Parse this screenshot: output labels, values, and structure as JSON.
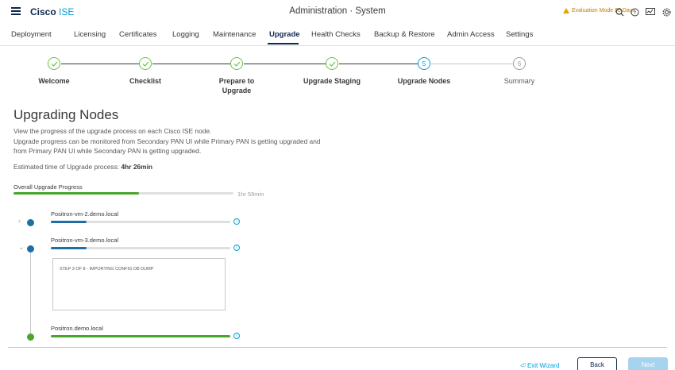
{
  "header": {
    "brand_name": "Cisco",
    "brand_product": "ISE",
    "title": "Administration · System",
    "evaluation_text": "Evaluation Mode 90 Days",
    "icons": [
      "menu-icon",
      "warning-icon",
      "search-icon",
      "help-icon",
      "dashboard-icon",
      "gear-icon"
    ]
  },
  "tabs": [
    {
      "label": "Deployment"
    },
    {
      "label": "Licensing"
    },
    {
      "label": "Certificates"
    },
    {
      "label": "Logging"
    },
    {
      "label": "Maintenance"
    },
    {
      "label": "Upgrade",
      "active": true
    },
    {
      "label": "Health Checks"
    },
    {
      "label": "Backup & Restore"
    },
    {
      "label": "Admin Access"
    },
    {
      "label": "Settings"
    }
  ],
  "stepper": {
    "steps": [
      {
        "label": "Welcome",
        "status": "done"
      },
      {
        "label": "Checklist",
        "status": "done"
      },
      {
        "label_line1": "Prepare to",
        "label_line2": "Upgrade",
        "status": "done"
      },
      {
        "label": "Upgrade Staging",
        "status": "done"
      },
      {
        "label": "Upgrade Nodes",
        "number": "5",
        "status": "current"
      },
      {
        "label": "Summary",
        "number": "6",
        "status": "pending"
      }
    ]
  },
  "main": {
    "title": "Upgrading Nodes",
    "desc_line1": "View the progress of the upgrade process on each Cisco ISE node.",
    "desc_line2": "Upgrade progress can be monitored from Secondary PAN UI while Primary PAN is getting upgraded and",
    "desc_line3": "from Primary PAN UI while Secondary PAN is getting upgraded.",
    "estimate_label": "Estimated time of Upgrade process:",
    "estimate_value": "4hr 26min",
    "overall_label": "Overall Upgrade Progress",
    "overall_progress": 0.57,
    "overall_time": "1hr 59min"
  },
  "nodes": [
    {
      "name": "Positron-vm-2.demo.local",
      "progress": 0.2,
      "status": "in-progress",
      "expanded": false
    },
    {
      "name": "Positron-vm-3.demo.local",
      "progress": 0.2,
      "status": "in-progress",
      "expanded": true,
      "step_text": "STEP 3 OF 8 - IMPORTING CONFIG DB DUMP"
    },
    {
      "name": "Positron.demo.local",
      "progress": 1.0,
      "status": "done"
    }
  ],
  "footer": {
    "exit_label": "Exit Wizard",
    "back_label": "Back",
    "next_label": "Next"
  },
  "colors": {
    "accent": "#049fd9",
    "brand_dark": "#0d274d",
    "success": "#4aa52d",
    "progress_blue": "#1e6fa5",
    "warning": "#e8a300"
  }
}
